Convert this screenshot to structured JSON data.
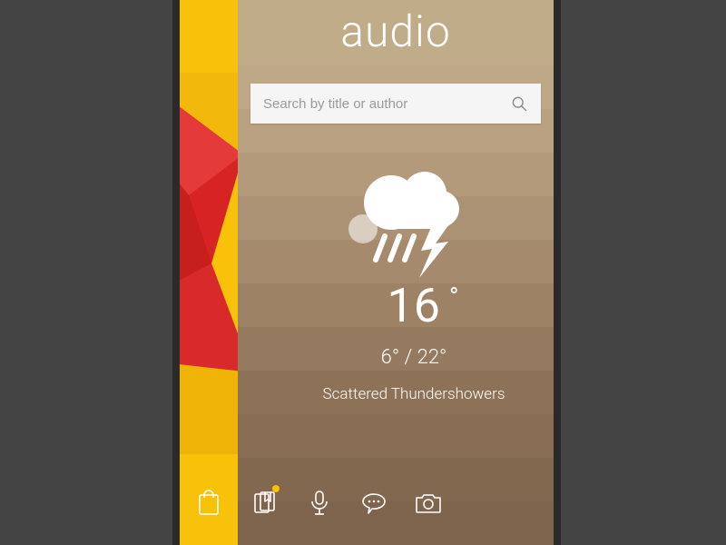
{
  "header": {
    "title": "audio"
  },
  "search": {
    "placeholder": "Search by title or author"
  },
  "weather": {
    "temp_value": "16",
    "temp_low": "6°",
    "temp_sep": "  /  ",
    "temp_high": "22°",
    "condition": "Scattered Thundershowers"
  }
}
